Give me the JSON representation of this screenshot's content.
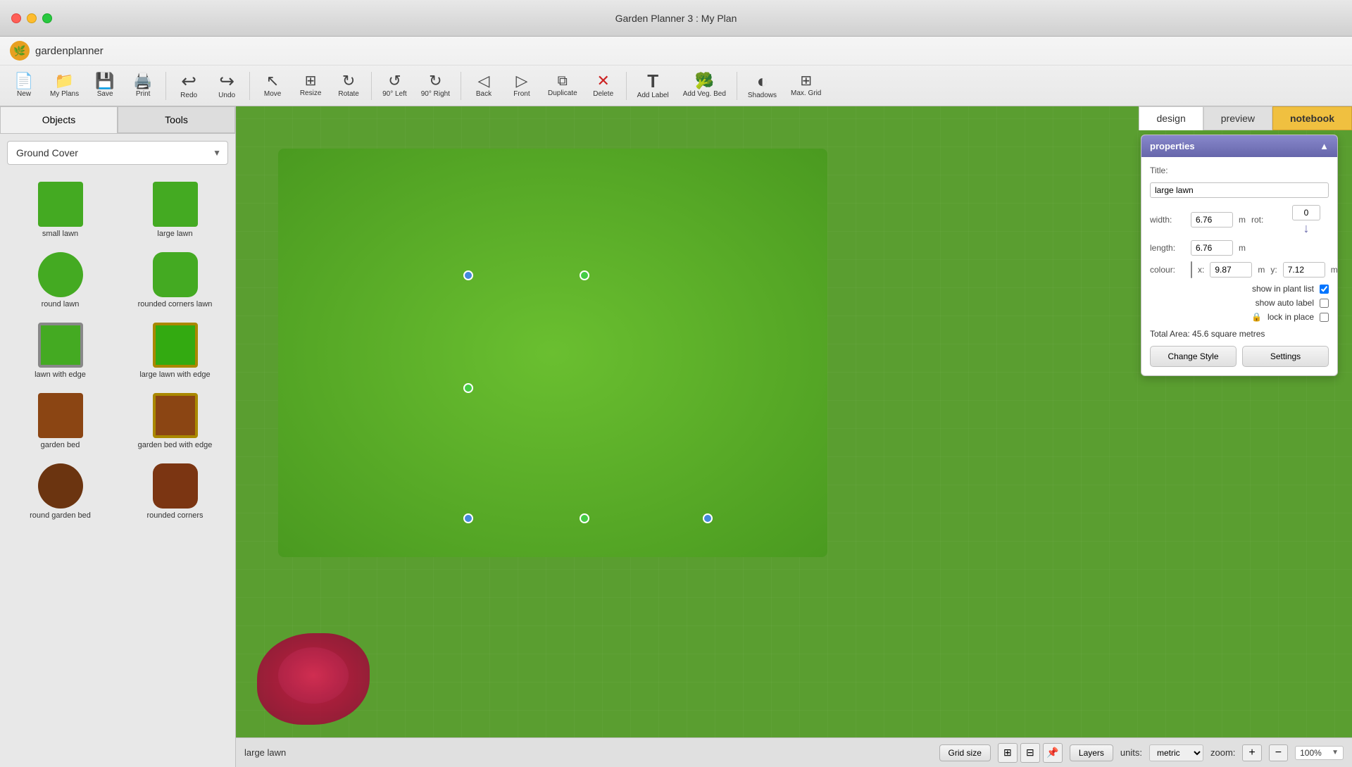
{
  "titleBar": {
    "title": "Garden Planner 3 : My  Plan"
  },
  "brand": {
    "logo": "🌿",
    "name": "gardenplanner"
  },
  "toolbar": {
    "buttons": [
      {
        "id": "new",
        "label": "New",
        "icon": "📄",
        "disabled": false
      },
      {
        "id": "my-plans",
        "label": "My Plans",
        "icon": "📁",
        "disabled": false
      },
      {
        "id": "save",
        "label": "Save",
        "icon": "💾",
        "disabled": false
      },
      {
        "id": "print",
        "label": "Print",
        "icon": "🖨️",
        "disabled": false
      },
      {
        "id": "undo",
        "label": "Undo",
        "icon": "↩",
        "disabled": false
      },
      {
        "id": "redo",
        "label": "Redo",
        "icon": "↪",
        "disabled": false
      },
      {
        "id": "move",
        "label": "Move",
        "icon": "↖",
        "disabled": false
      },
      {
        "id": "resize",
        "label": "Resize",
        "icon": "⊞",
        "disabled": false
      },
      {
        "id": "rotate",
        "label": "Rotate",
        "icon": "↻",
        "disabled": false
      },
      {
        "id": "90left",
        "label": "90° Left",
        "icon": "↺",
        "disabled": false
      },
      {
        "id": "90right",
        "label": "90° Right",
        "icon": "↻",
        "disabled": false
      },
      {
        "id": "back",
        "label": "Back",
        "icon": "◁",
        "disabled": false
      },
      {
        "id": "front",
        "label": "Front",
        "icon": "▷",
        "disabled": false
      },
      {
        "id": "duplicate",
        "label": "Duplicate",
        "icon": "⧉",
        "disabled": false
      },
      {
        "id": "delete",
        "label": "Delete",
        "icon": "✕",
        "disabled": false
      },
      {
        "id": "add-label",
        "label": "Add Label",
        "icon": "T",
        "disabled": false
      },
      {
        "id": "add-veg-bed",
        "label": "Add Veg. Bed",
        "icon": "🥦",
        "disabled": false
      },
      {
        "id": "shadows",
        "label": "Shadows",
        "icon": "◐",
        "disabled": false
      },
      {
        "id": "max-grid",
        "label": "Max. Grid",
        "icon": "⊞",
        "disabled": false
      }
    ]
  },
  "sidebar": {
    "tabs": [
      {
        "id": "objects",
        "label": "Objects",
        "active": true
      },
      {
        "id": "tools",
        "label": "Tools",
        "active": false
      }
    ],
    "categoryLabel": "Ground Cover",
    "category": "Ground Cover",
    "objects": [
      {
        "id": "small-lawn",
        "label": "small lawn",
        "color": "#44aa22",
        "shape": "square"
      },
      {
        "id": "large-lawn",
        "label": "large lawn",
        "color": "#44aa22",
        "shape": "square"
      },
      {
        "id": "round-lawn",
        "label": "round lawn",
        "color": "#44aa22",
        "shape": "circle"
      },
      {
        "id": "rounded-corners-lawn",
        "label": "rounded corners lawn",
        "color": "#44aa22",
        "shape": "rounded"
      },
      {
        "id": "lawn-with-edge",
        "label": "lawn with edge",
        "color": "#44aa22",
        "shape": "square",
        "hasBorder": true
      },
      {
        "id": "large-lawn-with-edge",
        "label": "large lawn with edge",
        "color": "#33aa11",
        "shape": "square",
        "hasBorder": true
      },
      {
        "id": "garden-bed",
        "label": "garden bed",
        "color": "#8B4513",
        "shape": "square"
      },
      {
        "id": "garden-bed-with-edge",
        "label": "garden bed with edge",
        "color": "#8B4513",
        "shape": "square",
        "hasBorder": true
      },
      {
        "id": "round-garden-bed",
        "label": "round garden bed",
        "color": "#6B3410",
        "shape": "circle"
      },
      {
        "id": "rounded-corners",
        "label": "rounded corners",
        "color": "#7B3512",
        "shape": "rounded"
      }
    ]
  },
  "viewTabs": [
    {
      "id": "design",
      "label": "design",
      "active": true
    },
    {
      "id": "preview",
      "label": "preview",
      "active": false
    },
    {
      "id": "notebook",
      "label": "notebook",
      "active": false
    }
  ],
  "properties": {
    "header": "properties",
    "title": {
      "label": "Title:",
      "value": "large lawn"
    },
    "width": {
      "label": "width:",
      "value": "6.76",
      "unit": "m"
    },
    "length": {
      "label": "length:",
      "value": "6.76",
      "unit": "m"
    },
    "rot": {
      "label": "rot:",
      "value": "0"
    },
    "colour": {
      "label": "colour:"
    },
    "x": {
      "label": "x:",
      "value": "9.87",
      "unit": "m"
    },
    "y": {
      "label": "y:",
      "value": "7.12",
      "unit": "m"
    },
    "checkboxes": {
      "showInPlantList": {
        "label": "show in plant list",
        "checked": true
      },
      "showAutoLabel": {
        "label": "show auto label",
        "checked": false
      },
      "lockInPlace": {
        "label": "lock in place",
        "checked": false
      }
    },
    "totalArea": "Total Area: 45.6 square metres",
    "buttons": {
      "changeStyle": "Change Style",
      "settings": "Settings"
    }
  },
  "bottomBar": {
    "objectLabel": "large lawn",
    "gridSizeLabel": "Grid size",
    "layersLabel": "Layers",
    "unitsLabel": "units:",
    "unitsValue": "metric",
    "zoomLabel": "zoom:",
    "zoomValue": "100%"
  }
}
